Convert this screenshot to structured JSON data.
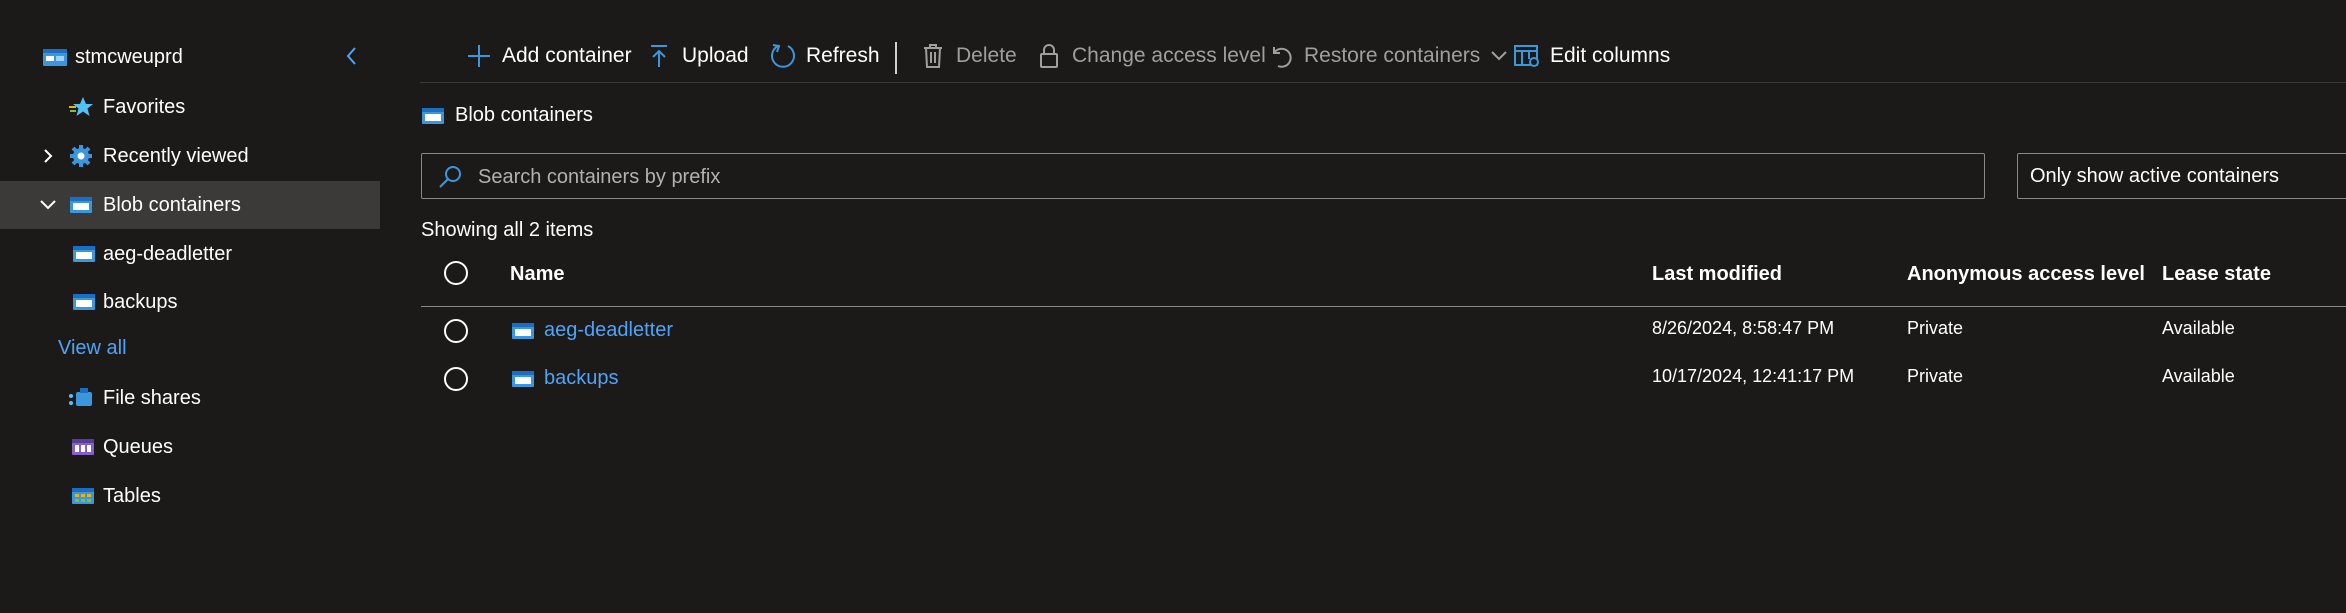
{
  "sidebar": {
    "account_name": "stmcweuprd",
    "items": [
      {
        "label": "Favorites",
        "icon": "favorites-star-icon"
      },
      {
        "label": "Recently viewed",
        "icon": "gear-icon"
      },
      {
        "label": "Blob containers",
        "icon": "blob-container-icon"
      },
      {
        "label": "aeg-deadletter",
        "icon": "blob-container-icon"
      },
      {
        "label": "backups",
        "icon": "blob-container-icon"
      },
      {
        "label": "File shares",
        "icon": "file-share-icon"
      },
      {
        "label": "Queues",
        "icon": "queue-icon"
      },
      {
        "label": "Tables",
        "icon": "table-icon"
      }
    ],
    "view_all": "View all"
  },
  "toolbar": {
    "add_container": "Add container",
    "upload": "Upload",
    "refresh": "Refresh",
    "delete": "Delete",
    "change_access_level": "Change access level",
    "restore_containers": "Restore containers",
    "edit_columns": "Edit columns"
  },
  "main": {
    "section_title": "Blob containers",
    "search_placeholder": "Search containers by prefix",
    "filter_value": "Only show active containers",
    "count_text": "Showing all 2 items",
    "columns": [
      "Name",
      "Last modified",
      "Anonymous access level",
      "Lease state"
    ],
    "rows": [
      {
        "name": "aeg-deadletter",
        "last_modified": "8/26/2024, 8:58:47 PM",
        "access": "Private",
        "lease": "Available"
      },
      {
        "name": "backups",
        "last_modified": "10/17/2024, 12:41:17 PM",
        "access": "Private",
        "lease": "Available"
      }
    ]
  },
  "colors": {
    "background": "#1b1a19",
    "selected": "#3b3a39",
    "link": "#4fa3f7",
    "accent": "#3a96dd"
  }
}
